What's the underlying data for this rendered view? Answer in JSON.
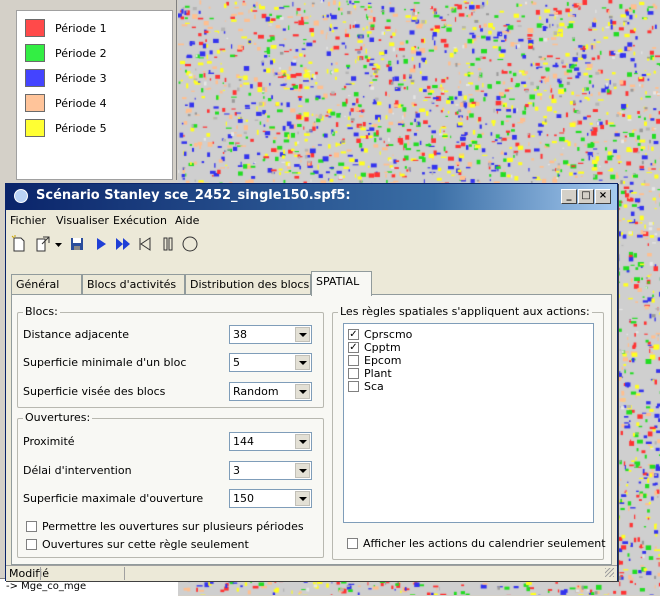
{
  "legend": {
    "items": [
      {
        "label": "Période 1",
        "color": "#ff4a4a"
      },
      {
        "label": "Période 2",
        "color": "#33ee44"
      },
      {
        "label": "Période 3",
        "color": "#4444ff"
      },
      {
        "label": "Période 4",
        "color": "#ffc49a"
      },
      {
        "label": "Période 5",
        "color": "#ffff33"
      }
    ]
  },
  "map": {
    "background_color": "#cfcfcf",
    "patch_colors": [
      "#ff3333",
      "#22dd22",
      "#3333ee",
      "#ffbf8f",
      "#ffff22"
    ]
  },
  "bottom_strip": {
    "text": "-> Mge_co_mge"
  },
  "window": {
    "title": "Scénario Stanley sce_2452_single150.spf5:",
    "minimize": "_",
    "maximize": "□",
    "close": "×"
  },
  "menu": {
    "items": [
      "Fichier",
      "Visualiser",
      "Exécution",
      "Aide"
    ]
  },
  "toolbar": {
    "icons": [
      "new-icon",
      "export-icon",
      "dropdown-arrow-icon",
      "save-icon",
      "play-icon",
      "fast-forward-icon",
      "rewind-icon",
      "pause-icon",
      "stop-icon"
    ]
  },
  "tabs": [
    {
      "label": "Général"
    },
    {
      "label": "Blocs d'activités"
    },
    {
      "label": "Distribution des blocs"
    },
    {
      "label": "SPATIAL"
    }
  ],
  "blocs": {
    "title": "Blocs:",
    "fields": [
      {
        "label": "Distance adjacente",
        "value": "38"
      },
      {
        "label": "Superficie minimale d'un bloc",
        "value": "5"
      },
      {
        "label": "Superficie visée des blocs",
        "value": "Random"
      }
    ]
  },
  "ouvertures": {
    "title": "Ouvertures:",
    "fields": [
      {
        "label": "Proximité",
        "value": "144"
      },
      {
        "label": "Délai d'intervention",
        "value": "3"
      },
      {
        "label": "Superficie maximale d'ouverture",
        "value": "150"
      }
    ],
    "checks": [
      {
        "label": "Permettre les ouvertures sur plusieurs périodes",
        "checked": false
      },
      {
        "label": "Ouvertures sur cette règle seulement",
        "checked": false
      }
    ]
  },
  "rules": {
    "title": "Les règles spatiales s'appliquent aux actions:",
    "actions": [
      {
        "label": "Cprscmo",
        "checked": true
      },
      {
        "label": "Cpptm",
        "checked": true
      },
      {
        "label": "Epcom",
        "checked": false
      },
      {
        "label": "Plant",
        "checked": false
      },
      {
        "label": "Sca",
        "checked": false
      }
    ],
    "calendar_check": {
      "label": "Afficher les actions du calendrier seulement",
      "checked": false
    }
  },
  "status": {
    "text": "Modifié"
  }
}
